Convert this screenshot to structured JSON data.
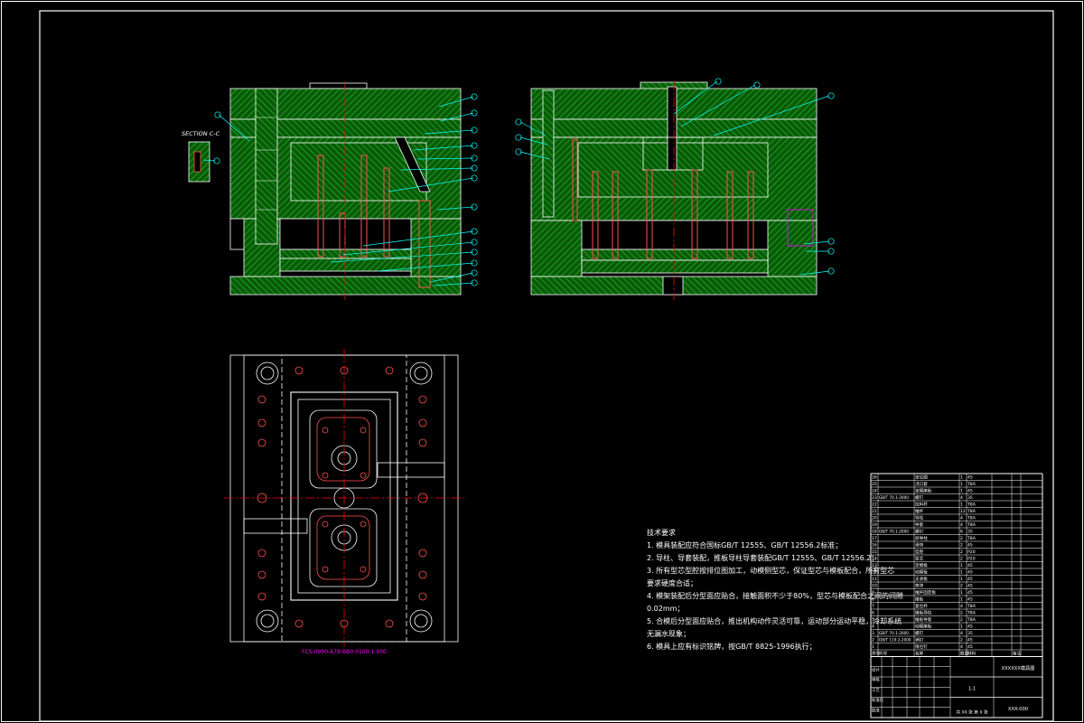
{
  "section_label": "SECTION C-C",
  "plan_caption": "FCS-0990-A7B-BB0-0100-1.000",
  "notes": {
    "title": "技术要求",
    "lines": [
      "1. 模具装配应符合国标GB/T 12555、GB/T 12556.2标准；",
      "2. 导柱、导套装配，推板导柱导套装配GB/T 12555、GB/T 12556.2；",
      "3. 所有型芯型腔按排位图加工，动模侧型芯，保证型芯与模板配合，所有型芯",
      "   要求硬度合适；",
      "4. 模架装配后分型面应贴合，接触面积不少于80%，型芯与模板配合之间的间隙",
      "   0.02mm；",
      "5. 合模后分型面应贴合，推出机构动作灵活可靠，运动部分运动平稳，冷却系统",
      "   无漏水现象；",
      "6. 模具上应有标识铭牌，按GB/T 8825-1996执行；"
    ]
  },
  "title_block": {
    "drawing_name": "XXXXXX模具图",
    "drawing_number": "XXX-000",
    "scale": "1:1",
    "sheet": "共 XX 张 第 X 张",
    "row_labels": [
      "设计",
      "审核",
      "工艺",
      "标准化",
      "批准"
    ],
    "headers": [
      "序号",
      "代号",
      "名称",
      "数量",
      "材料",
      "备注"
    ]
  },
  "bom_rows": [
    {
      "no": "26",
      "std": "",
      "name": "定位圈",
      "qty": "1",
      "mat": "45"
    },
    {
      "no": "25",
      "std": "",
      "name": "浇口套",
      "qty": "1",
      "mat": "T8A"
    },
    {
      "no": "24",
      "std": "",
      "name": "定模座板",
      "qty": "1",
      "mat": "45"
    },
    {
      "no": "23",
      "std": "GB/T 70.1-2000",
      "name": "螺钉",
      "qty": "4",
      "mat": "35"
    },
    {
      "no": "22",
      "std": "",
      "name": "拉料杆",
      "qty": "1",
      "mat": "T8A"
    },
    {
      "no": "21",
      "std": "",
      "name": "推杆",
      "qty": "12",
      "mat": "T8A"
    },
    {
      "no": "20",
      "std": "",
      "name": "导柱",
      "qty": "4",
      "mat": "T8A"
    },
    {
      "no": "19",
      "std": "",
      "name": "导套",
      "qty": "4",
      "mat": "T8A"
    },
    {
      "no": "18",
      "std": "GB/T 70.1-2000",
      "name": "螺钉",
      "qty": "6",
      "mat": "35"
    },
    {
      "no": "17",
      "std": "",
      "name": "斜导柱",
      "qty": "2",
      "mat": "T8A"
    },
    {
      "no": "16",
      "std": "",
      "name": "滑块",
      "qty": "2",
      "mat": "45"
    },
    {
      "no": "15",
      "std": "",
      "name": "型腔",
      "qty": "2",
      "mat": "P20"
    },
    {
      "no": "14",
      "std": "",
      "name": "型芯",
      "qty": "2",
      "mat": "P20"
    },
    {
      "no": "13",
      "std": "",
      "name": "定模板",
      "qty": "1",
      "mat": "45"
    },
    {
      "no": "12",
      "std": "",
      "name": "动模板",
      "qty": "1",
      "mat": "45"
    },
    {
      "no": "11",
      "std": "",
      "name": "支承板",
      "qty": "1",
      "mat": "45"
    },
    {
      "no": "10",
      "std": "",
      "name": "垫块",
      "qty": "2",
      "mat": "45"
    },
    {
      "no": "9",
      "std": "",
      "name": "推杆固定板",
      "qty": "1",
      "mat": "45"
    },
    {
      "no": "8",
      "std": "",
      "name": "推板",
      "qty": "1",
      "mat": "45"
    },
    {
      "no": "7",
      "std": "",
      "name": "复位杆",
      "qty": "4",
      "mat": "T8A"
    },
    {
      "no": "6",
      "std": "",
      "name": "推板导柱",
      "qty": "2",
      "mat": "T8A"
    },
    {
      "no": "5",
      "std": "",
      "name": "推板导套",
      "qty": "2",
      "mat": "T8A"
    },
    {
      "no": "4",
      "std": "",
      "name": "动模座板",
      "qty": "1",
      "mat": "45"
    },
    {
      "no": "3",
      "std": "GB/T 70.1-2000",
      "name": "螺钉",
      "qty": "4",
      "mat": "35"
    },
    {
      "no": "2",
      "std": "GB/T 119.2-2000",
      "name": "销钉",
      "qty": "2",
      "mat": "45"
    },
    {
      "no": "1",
      "std": "",
      "name": "限位钉",
      "qty": "4",
      "mat": "45"
    }
  ],
  "colors": {
    "background": "#000000",
    "border": "#ffffff",
    "hatch": "#00c800",
    "leader": "#00ffff",
    "centerline": "#ff0000",
    "part_line": "#ffffff",
    "caption": "#ff00ff",
    "ejector": "#ff5050",
    "table_line": "#ffffff"
  }
}
